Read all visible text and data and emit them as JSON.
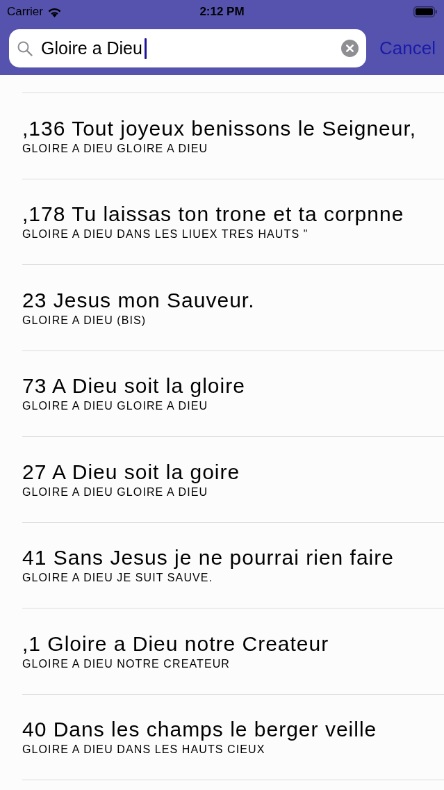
{
  "status_bar": {
    "carrier": "Carrier",
    "time": "2:12 PM"
  },
  "search": {
    "value": "Gloire a Dieu",
    "cancel": "Cancel"
  },
  "results": [
    {
      "title": ",136 Tout joyeux benissons le Seigneur,",
      "subtitle": "GLOIRE A DIEU GLOIRE A DIEU"
    },
    {
      "title": ",178 Tu laissas ton trone et ta corpnne",
      "subtitle": "GLOIRE A DIEU DANS LES LIUEX TRES HAUTS \""
    },
    {
      "title": "23 Jesus mon Sauveur.",
      "subtitle": "GLOIRE A DIEU (BIS)"
    },
    {
      "title": "73 A Dieu soit la gloire",
      "subtitle": "GLOIRE A DIEU GLOIRE A DIEU"
    },
    {
      "title": "27 A Dieu soit la goire",
      "subtitle": "GLOIRE A DIEU GLOIRE A DIEU"
    },
    {
      "title": "41 Sans Jesus je ne pourrai rien faire",
      "subtitle": "GLOIRE A DIEU JE SUIT SAUVE."
    },
    {
      "title": ",1 Gloire a Dieu notre Createur",
      "subtitle": "GLOIRE A DIEU NOTRE CREATEUR"
    },
    {
      "title": "40 Dans les champs le berger veille",
      "subtitle": "GLOIRE A DIEU DANS LES HAUTS CIEUX"
    }
  ]
}
